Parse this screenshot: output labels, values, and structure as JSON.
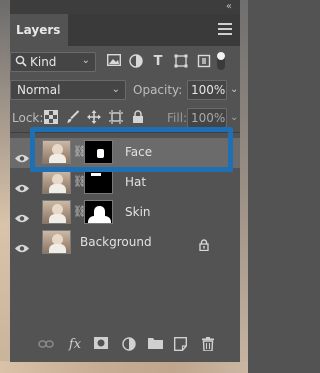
{
  "panel": {
    "tab_label": "Layers",
    "collapse_glyph": "«",
    "menu_icon": "hamburger-menu-icon"
  },
  "filter": {
    "kind_label": "Kind",
    "icons": [
      "image-filter-icon",
      "adjustment-filter-icon",
      "type-filter-icon",
      "shape-filter-icon",
      "smart-object-filter-icon"
    ],
    "type_glyph": "T",
    "toggle_on": true
  },
  "blend": {
    "mode": "Normal",
    "opacity_label": "Opacity:",
    "opacity_value": "100%"
  },
  "lock": {
    "label": "Lock:",
    "fill_label": "Fill:",
    "fill_value": "100%"
  },
  "layers": [
    {
      "name": "Face",
      "selected": true,
      "visible": true,
      "has_mask": true
    },
    {
      "name": "Hat",
      "selected": false,
      "visible": true,
      "has_mask": true
    },
    {
      "name": "Skin",
      "selected": false,
      "visible": true,
      "has_mask": true
    },
    {
      "name": "Background",
      "selected": false,
      "visible": true,
      "has_mask": false,
      "locked": true
    }
  ],
  "colors": {
    "panel_bg": "#535353",
    "selection_outline": "#1f6fb5",
    "selected_row": "#6b6b6b"
  },
  "bottom_bar": {
    "fx_label": "fx",
    "icons": [
      "link-layers-icon",
      "fx-icon",
      "add-mask-icon",
      "adjustment-layer-icon",
      "new-group-icon",
      "new-layer-icon",
      "trash-icon"
    ]
  }
}
